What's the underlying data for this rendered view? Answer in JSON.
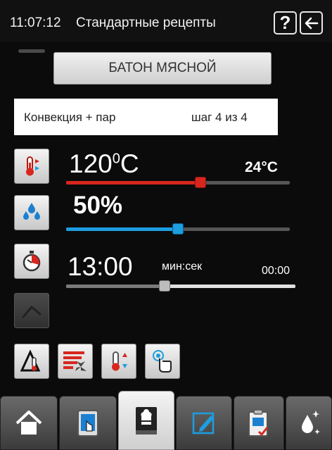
{
  "header": {
    "clock": "11:07:12",
    "title": "Стандартные рецепты",
    "help_label": "?"
  },
  "recipe": {
    "name": "БАТОН МЯСНОЙ"
  },
  "mode": {
    "label": "Конвекция  + пар",
    "step": "шаг 4 из 4"
  },
  "temperature": {
    "value": "120",
    "degree": "0",
    "unit": "C",
    "current": "24°C",
    "level_fraction": 0.6,
    "color": "#d8261e"
  },
  "humidity": {
    "value": "50%",
    "level_fraction": 0.5,
    "color": "#1c9ee0"
  },
  "time": {
    "value": "13:00",
    "unit_label": "мин:сек",
    "elapsed": "00:00",
    "level_fraction": 0.43
  },
  "icons": {
    "temp": "thermometer-icon",
    "humidity": "water-drops-icon",
    "time": "stopwatch-icon",
    "probe": "core-probe-icon",
    "tools": [
      "delta-temperature-icon",
      "fan-heat-icon",
      "temperature-adjust-icon",
      "touch-clean-icon"
    ],
    "tabs": [
      "home-icon",
      "manual-mode-icon",
      "recipe-book-icon",
      "edit-icon",
      "programs-icon",
      "cleaning-icon"
    ]
  }
}
